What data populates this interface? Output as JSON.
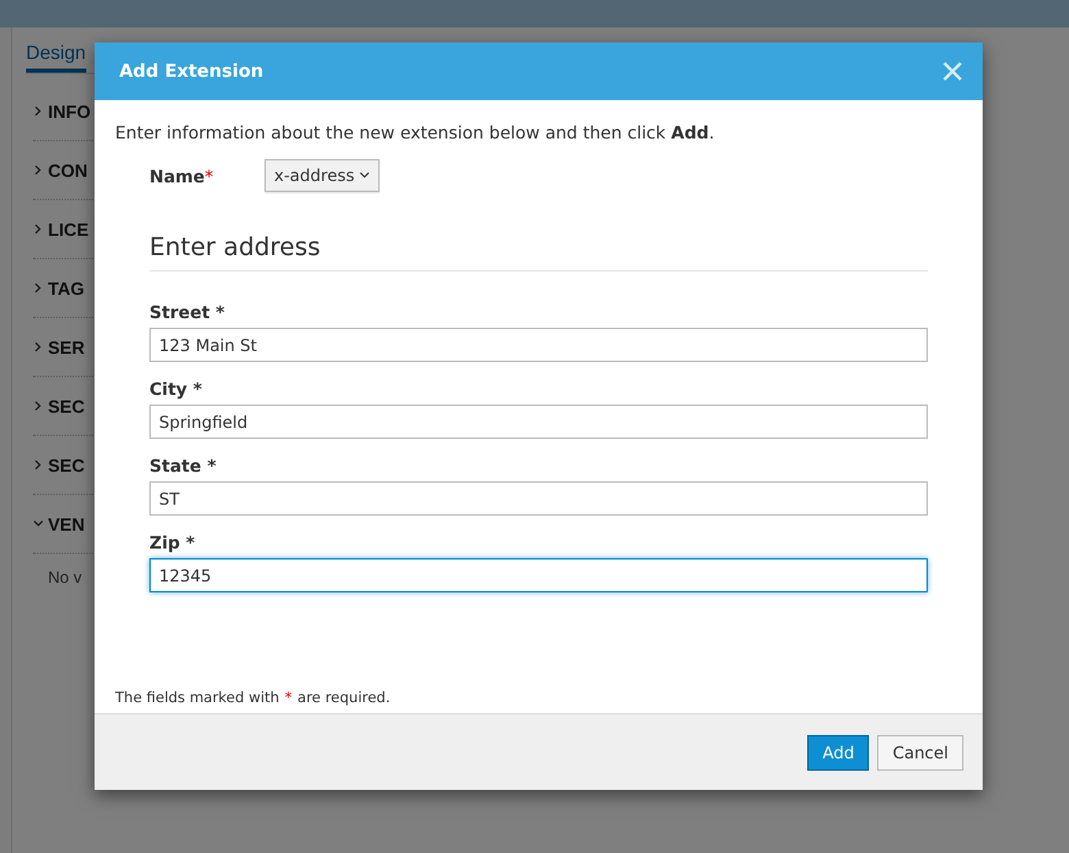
{
  "background": {
    "tab": {
      "label": "Design",
      "selected": true
    },
    "sections": [
      {
        "label": "INFO",
        "expanded": false
      },
      {
        "label": "CON",
        "expanded": false
      },
      {
        "label": "LICE",
        "expanded": false
      },
      {
        "label": "TAG",
        "expanded": false
      },
      {
        "label": "SER",
        "expanded": false
      },
      {
        "label": "SEC",
        "expanded": false
      },
      {
        "label": "SEC",
        "expanded": false
      },
      {
        "label": "VEN",
        "expanded": true,
        "content": "No v"
      }
    ]
  },
  "dialog": {
    "title": "Add Extension",
    "intro": "Enter information about the new extension below and then click **Add**.",
    "name_field": {
      "label": "Name",
      "required_mark": "*",
      "value": "x-address"
    },
    "section_title": "Enter address",
    "fields": [
      {
        "label": "Street *",
        "value": "123 Main St",
        "focused": false
      },
      {
        "label": "City *",
        "value": "Springfield",
        "focused": false
      },
      {
        "label": "State *",
        "value": "ST",
        "focused": false
      },
      {
        "label": "Zip *",
        "value": "12345",
        "focused": true
      }
    ],
    "footnote": {
      "before": "The fields marked with",
      "mark": "*",
      "after": "are required."
    },
    "buttons": [
      {
        "label": "Add",
        "kind": "primary"
      },
      {
        "label": "Cancel",
        "kind": "default"
      }
    ]
  }
}
